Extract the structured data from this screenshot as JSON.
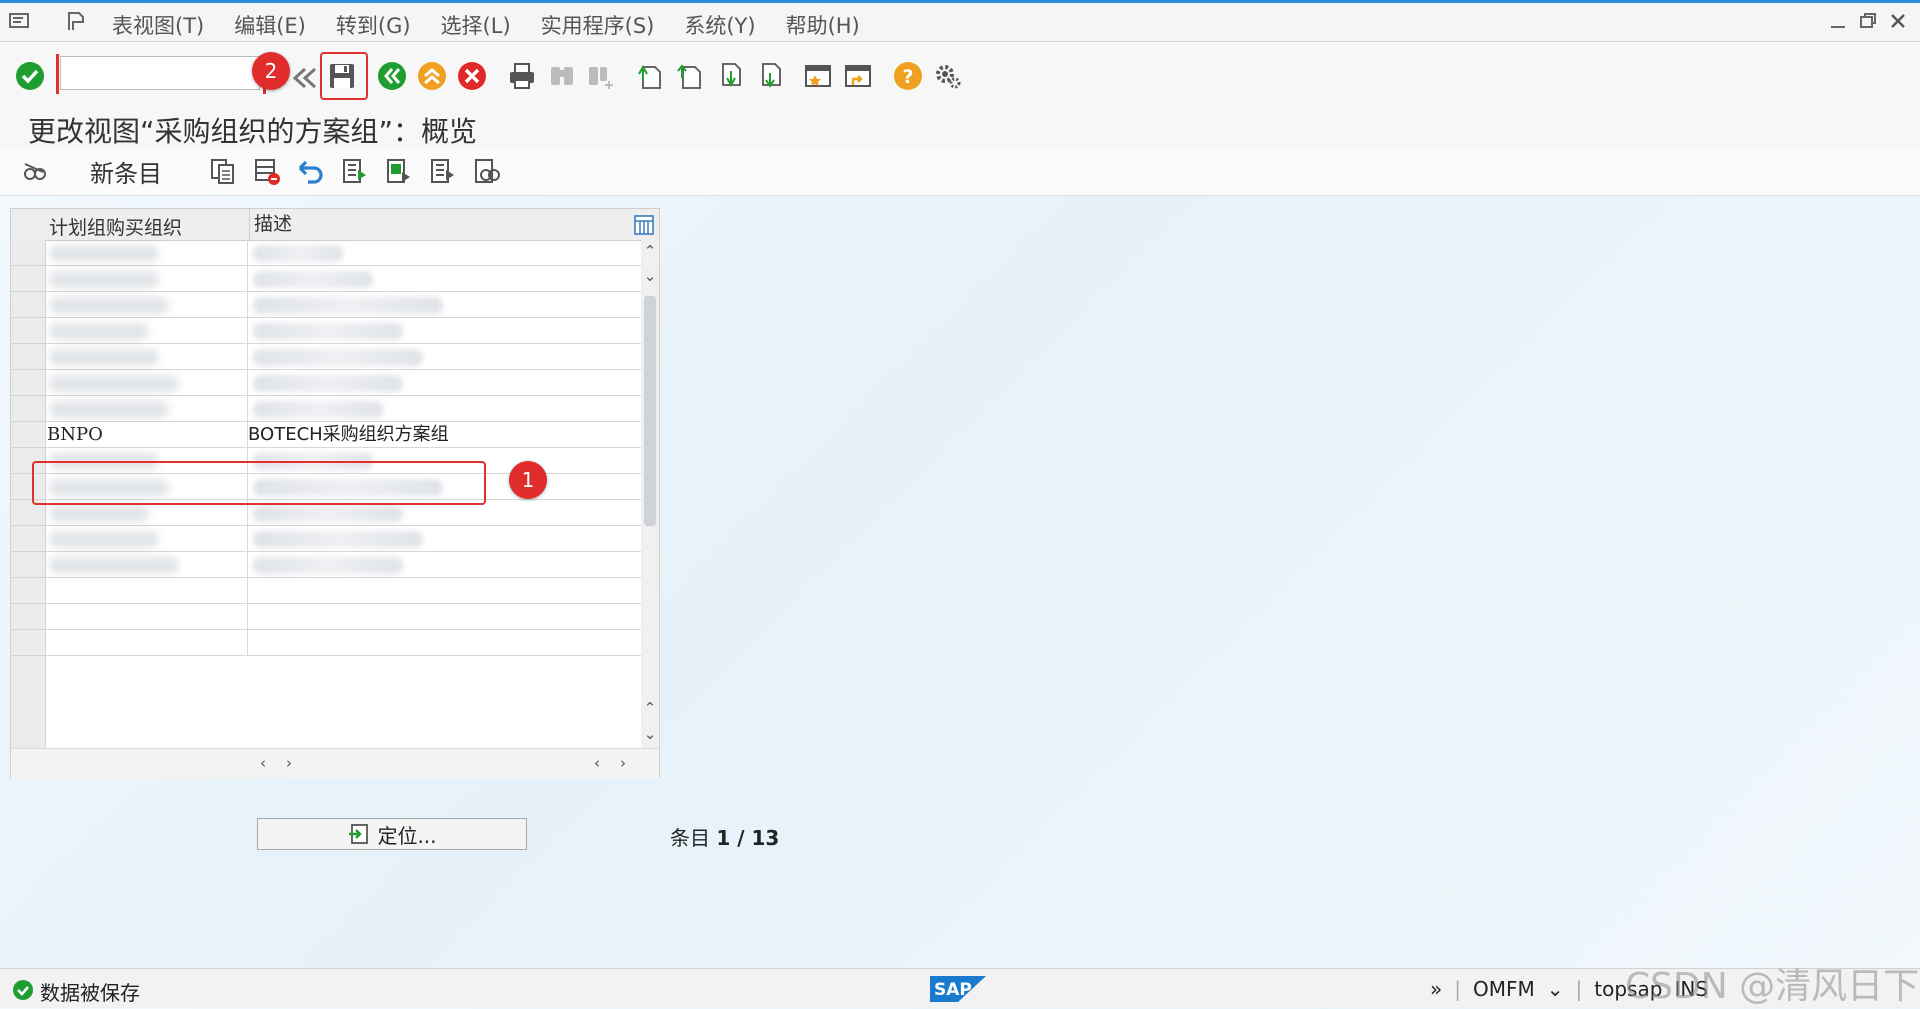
{
  "menu": {
    "items": [
      "表视图(T)",
      "编辑(E)",
      "转到(G)",
      "选择(L)",
      "实用程序(S)",
      "系统(Y)",
      "帮助(H)"
    ]
  },
  "toolbar": {
    "command_value": "",
    "badge_save": "2"
  },
  "page": {
    "title": "更改视图“采购组织的方案组”：概览"
  },
  "app_toolbar": {
    "new_entries_label": "新条目"
  },
  "grid": {
    "columns": [
      "计划组购买组织",
      "描述"
    ],
    "rows": [
      {
        "code": "",
        "desc": "",
        "blurred": true
      },
      {
        "code": "",
        "desc": "",
        "blurred": true
      },
      {
        "code": "",
        "desc": "",
        "blurred": true
      },
      {
        "code": "",
        "desc": "",
        "blurred": true
      },
      {
        "code": "",
        "desc": "",
        "blurred": true
      },
      {
        "code": "",
        "desc": "",
        "blurred": true
      },
      {
        "code": "",
        "desc": "",
        "blurred": true
      },
      {
        "code": "BNPO",
        "desc": "BOTECH采购组织方案组",
        "blurred": false
      },
      {
        "code": "",
        "desc": "",
        "blurred": true
      },
      {
        "code": "",
        "desc": "",
        "blurred": true
      },
      {
        "code": "",
        "desc": "",
        "blurred": true
      },
      {
        "code": "",
        "desc": "",
        "blurred": true
      },
      {
        "code": "",
        "desc": "",
        "blurred": true
      },
      {
        "code": "",
        "desc": "",
        "blurred": false
      },
      {
        "code": "",
        "desc": "",
        "blurred": false
      },
      {
        "code": "",
        "desc": "",
        "blurred": false
      }
    ],
    "badge_row": "1"
  },
  "footer": {
    "locate_label": "定位...",
    "entry_label": "条目",
    "entry_value": "1 / 13"
  },
  "status": {
    "message": "数据被保存",
    "transaction": "OMFM",
    "system": "topsap",
    "mode": "INS",
    "watermark": "CSDN @清风日下"
  },
  "colors": {
    "accent": "#2a8bd8",
    "highlight": "#e03030",
    "green": "#1f9d2f",
    "orange": "#f0a020",
    "red": "#e02a2a"
  }
}
